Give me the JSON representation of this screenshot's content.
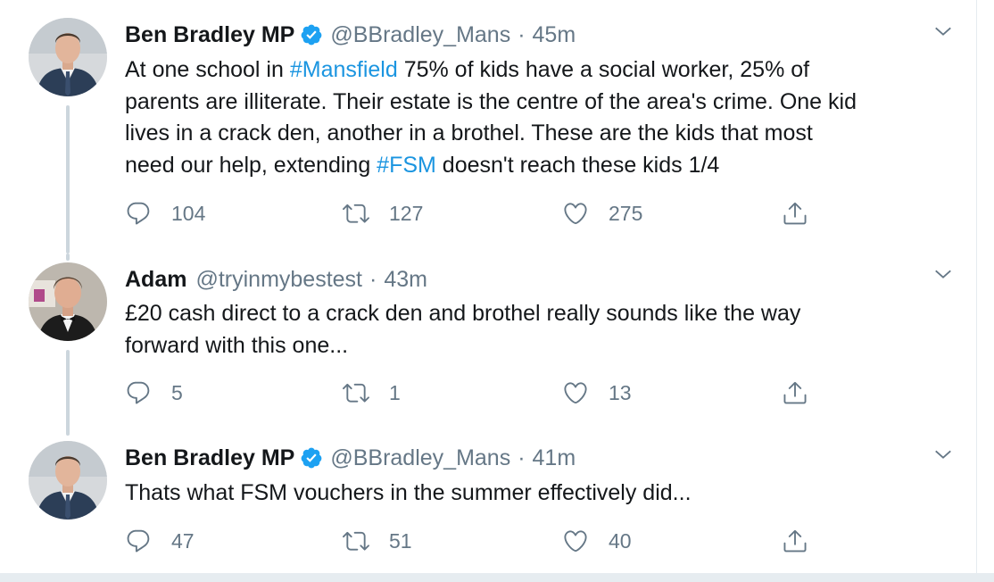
{
  "tweets": [
    {
      "name": "Ben Bradley MP",
      "verified": true,
      "handle": "@BBradley_Mans",
      "separator": "·",
      "time": "45m",
      "text_lines": [
        [
          {
            "t": "At one school in "
          },
          {
            "t": "#Mansfield",
            "tag": true
          },
          {
            "t": " 75% of kids have a social worker, 25% of"
          }
        ],
        [
          {
            "t": "parents are illiterate. Their estate is the centre of the area's crime. One kid"
          }
        ],
        [
          {
            "t": "lives in a crack den, another in a brothel. These are the kids that most"
          }
        ],
        [
          {
            "t": "need our help, extending "
          },
          {
            "t": "#FSM",
            "tag": true
          },
          {
            "t": " doesn't reach these kids 1/4"
          }
        ]
      ],
      "replies": "104",
      "retweets": "127",
      "likes": "275",
      "avatar": "ben-bradley-avatar"
    },
    {
      "name": "Adam",
      "verified": false,
      "handle": "@tryinmybestest",
      "separator": "·",
      "time": "43m",
      "text_lines": [
        [
          {
            "t": "£20 cash direct to a crack den and brothel really sounds like the way"
          }
        ],
        [
          {
            "t": "forward with this one..."
          }
        ]
      ],
      "replies": "5",
      "retweets": "1",
      "likes": "13",
      "avatar": "adam-avatar"
    },
    {
      "name": "Ben Bradley MP",
      "verified": true,
      "handle": "@BBradley_Mans",
      "separator": "·",
      "time": "41m",
      "text_lines": [
        [
          {
            "t": "Thats what FSM vouchers in the summer effectively did..."
          }
        ]
      ],
      "replies": "47",
      "retweets": "51",
      "likes": "40",
      "avatar": "ben-bradley-avatar"
    }
  ],
  "colors": {
    "link": "#1b95e0",
    "verified": "#1da1f2",
    "secondary_text": "#657786",
    "primary_text": "#14171a",
    "thread_line": "#ccd6dd"
  }
}
